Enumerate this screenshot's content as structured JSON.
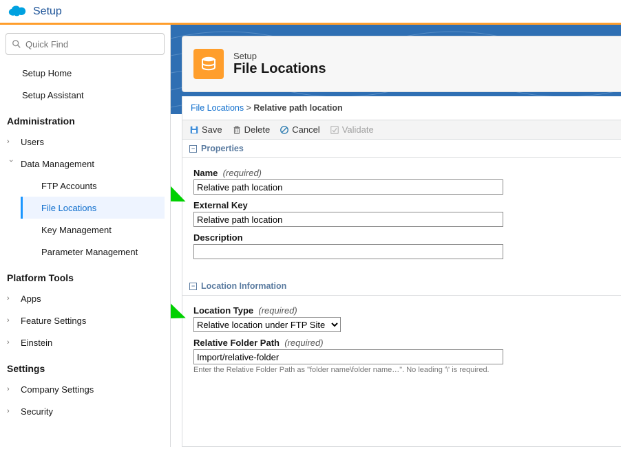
{
  "app": {
    "name": "Setup"
  },
  "sidebar": {
    "search_placeholder": "Quick Find",
    "top": [
      "Setup Home",
      "Setup Assistant"
    ],
    "sections": [
      {
        "label": "Administration",
        "items": [
          {
            "label": "Users",
            "expanded": false
          },
          {
            "label": "Data Management",
            "expanded": true,
            "children": [
              "FTP Accounts",
              "File Locations",
              "Key Management",
              "Parameter Management"
            ],
            "active_child": "File Locations"
          }
        ]
      },
      {
        "label": "Platform Tools",
        "items": [
          {
            "label": "Apps"
          },
          {
            "label": "Feature Settings"
          },
          {
            "label": "Einstein"
          }
        ]
      },
      {
        "label": "Settings",
        "items": [
          {
            "label": "Company Settings"
          },
          {
            "label": "Security"
          }
        ]
      }
    ]
  },
  "header": {
    "eyebrow": "Setup",
    "title": "File Locations"
  },
  "crumbs": {
    "root": "File Locations",
    "sep": ">",
    "current": "Relative path location"
  },
  "toolbar": {
    "save": "Save",
    "delete": "Delete",
    "cancel": "Cancel",
    "validate": "Validate"
  },
  "sections": {
    "properties": "Properties",
    "location_info": "Location Information"
  },
  "form": {
    "name_label": "Name",
    "name_value": "Relative path location",
    "extkey_label": "External Key",
    "extkey_value": "Relative path location",
    "desc_label": "Description",
    "desc_value": "",
    "loctype_label": "Location Type",
    "loctype_value": "Relative location under FTP Site",
    "relpath_label": "Relative Folder Path",
    "relpath_value": "Import/relative-folder",
    "relpath_hint": "Enter the Relative Folder Path as \"folder name\\folder name…\". No leading '\\' is required.",
    "required": "(required)"
  }
}
